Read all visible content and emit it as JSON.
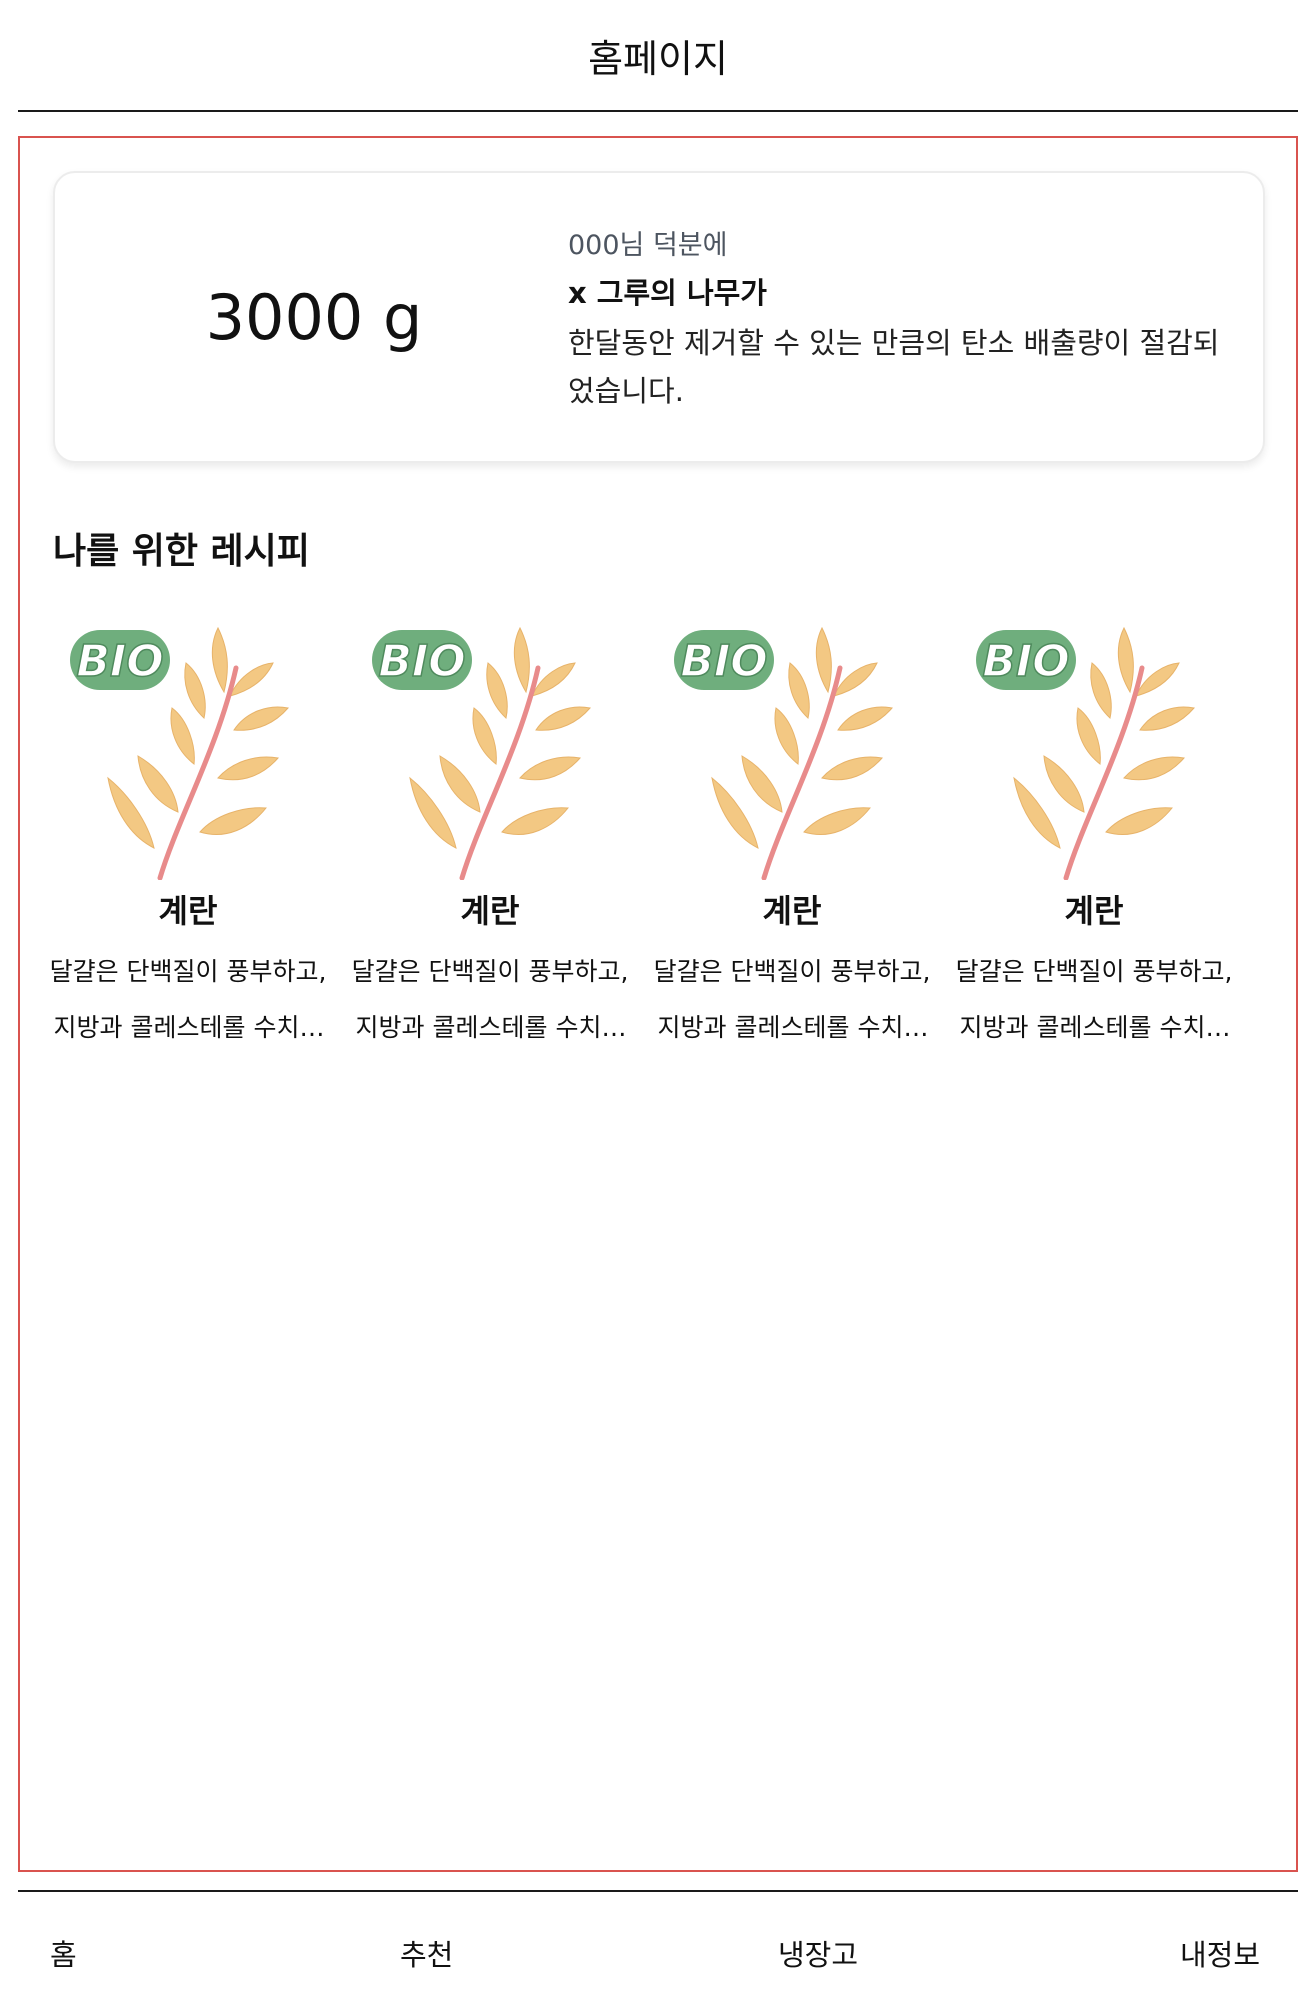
{
  "header": {
    "title": "홈페이지"
  },
  "savings": {
    "amount": "3000 g",
    "thanks": "000님 덕분에",
    "trees": "x 그루의 나무가",
    "description": "한달동안 제거할 수 있는 만큼의 탄소 배출량이 절감되었습니다."
  },
  "recommend": {
    "title": "나를 위한 레시피",
    "items": [
      {
        "badge": "BIO",
        "name": "계란",
        "description": "달걀은 단백질이 풍부하고, 지방과 콜레스테롤 수치가 높습니다."
      },
      {
        "badge": "BIO",
        "name": "계란",
        "description": "달걀은 단백질이 풍부하고, 지방과 콜레스테롤 수치가 높습니다."
      },
      {
        "badge": "BIO",
        "name": "계란",
        "description": "달걀은 단백질이 풍부하고, 지방과 콜레스테롤 수치가 높습니다."
      },
      {
        "badge": "BIO",
        "name": "계란",
        "description": "달걀은 단백질이 풍부하고, 지방과 콜레스테롤 수치가 높습니다."
      }
    ]
  },
  "tabbar": {
    "home": "홈",
    "recommend": "추천",
    "fridge": "냉장고",
    "my_info": "내정보"
  },
  "colors": {
    "frame_border": "#d9534f",
    "leaf": "#f3c883",
    "stem": "#e88b8b",
    "badge": "#6fae7d"
  }
}
